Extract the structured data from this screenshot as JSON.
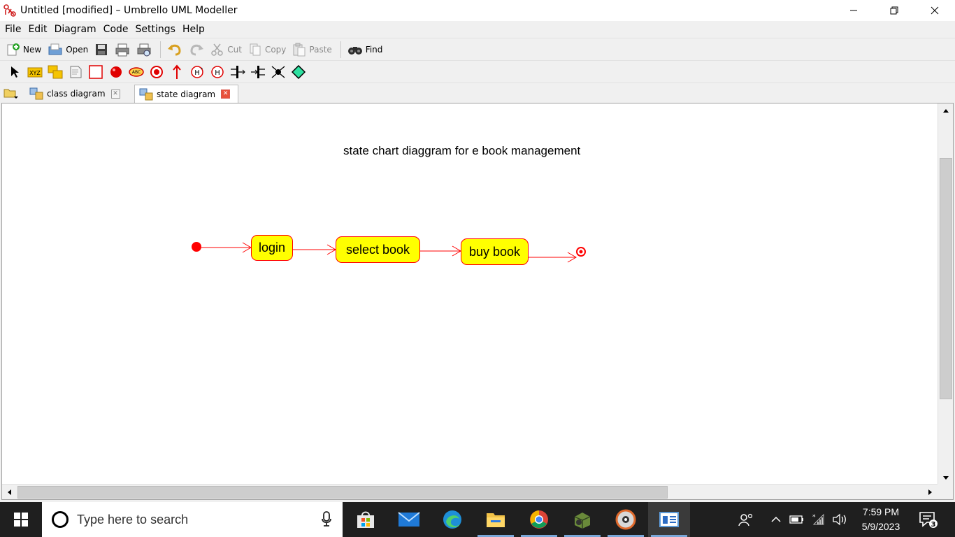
{
  "window": {
    "title": "Untitled [modified] – Umbrello UML Modeller"
  },
  "menu": [
    "File",
    "Edit",
    "Diagram",
    "Code",
    "Settings",
    "Help"
  ],
  "toolbar": {
    "new_label": "New",
    "open_label": "Open",
    "cut_label": "Cut",
    "copy_label": "Copy",
    "paste_label": "Paste",
    "find_label": "Find"
  },
  "diagram_toolbar": {
    "tools": [
      "select-arrow",
      "state",
      "activity",
      "note",
      "box",
      "initial-state",
      "end-state",
      "text",
      "final",
      "transition",
      "shallow-history",
      "deep-history",
      "join",
      "fork",
      "junction",
      "choice"
    ]
  },
  "tabs": [
    {
      "label": "class diagram",
      "active": false
    },
    {
      "label": "state diagram",
      "active": true
    }
  ],
  "diagram": {
    "title": "state chart diaggram for e book  management",
    "states": [
      "login",
      "select book",
      "buy book"
    ],
    "colors": {
      "state_fill": "#ffff00",
      "state_border": "#ff0000",
      "transition": "#ff0000"
    }
  },
  "taskbar": {
    "search_placeholder": "Type here to search",
    "time": "7:59 PM",
    "date": "5/9/2023",
    "notification_count": "3"
  }
}
